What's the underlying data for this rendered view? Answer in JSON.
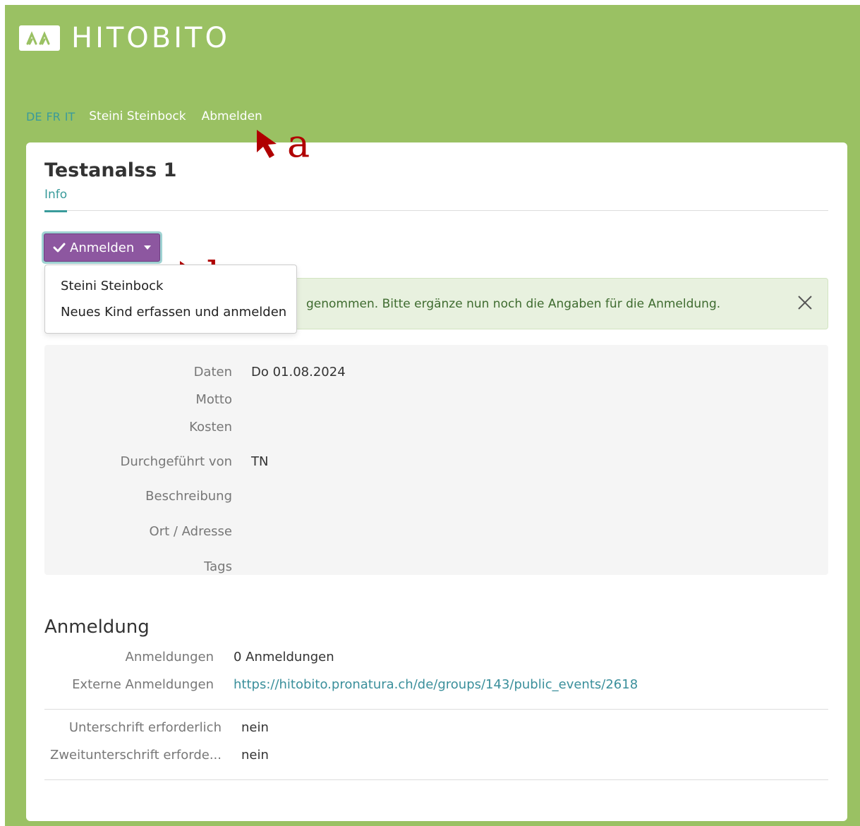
{
  "brand": {
    "name": "HITOBITO",
    "logo_icon": "two-peaks-logo-icon"
  },
  "topnav": {
    "languages": [
      "DE",
      "FR",
      "IT"
    ],
    "user": "Steini Steinbock",
    "logout": "Abmelden"
  },
  "annotations": {
    "a": "a",
    "b": "b",
    "arrow_color": "#b00000"
  },
  "event": {
    "title": "Testanalss 1",
    "tabs": [
      {
        "label": "Info"
      }
    ],
    "action_button": {
      "label": "Anmelden",
      "icon": "check-icon"
    },
    "dropdown": {
      "items": [
        {
          "label": "Steini Steinbock"
        },
        {
          "label": "Neues Kind erfassen und anmelden"
        }
      ]
    },
    "alert": {
      "text": "genommen. Bitte ergänze nun noch die Angaben für die Anmeldung.",
      "close_icon": "close-icon"
    },
    "details": [
      {
        "label": "Daten",
        "value": "Do 01.08.2024"
      },
      {
        "label": "Motto",
        "value": ""
      },
      {
        "label": "Kosten",
        "value": ""
      },
      {
        "label": "Durchgeführt von",
        "value": "TN"
      },
      {
        "label": "Beschreibung",
        "value": ""
      },
      {
        "label": "Ort / Adresse",
        "value": ""
      },
      {
        "label": "Tags",
        "value": ""
      }
    ],
    "anmeldung": {
      "title": "Anmeldung",
      "rows": [
        {
          "label": "Anmeldungen",
          "value": "0 Anmeldungen"
        },
        {
          "label": "Externe Anmeldungen",
          "value": "https://hitobito.pronatura.ch/de/groups/143/public_events/2618"
        }
      ],
      "rows2": [
        {
          "label": "Unterschrift erforderlich",
          "value": "nein"
        },
        {
          "label": "Zweitunterschrift erforde...",
          "value": "nein"
        }
      ]
    }
  },
  "colors": {
    "header_green": "#9ac163",
    "accent_teal": "#3a9b9b",
    "button_purple": "#8d57a0",
    "alert_bg": "#e8f1df"
  }
}
